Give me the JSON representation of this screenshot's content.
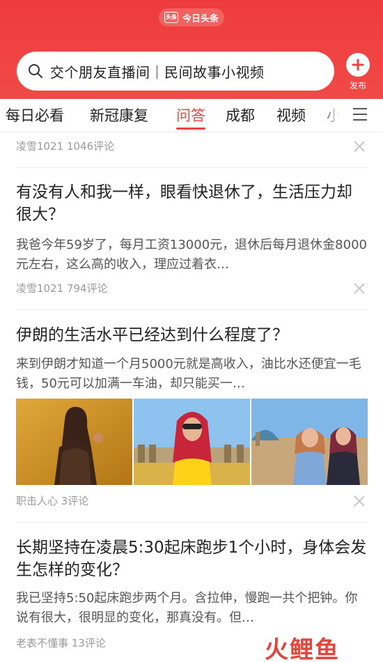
{
  "header": {
    "app_name": "今日头条",
    "badge_text": "头条",
    "search_placeholder": "交个朋友直播间｜民间故事小视频",
    "publish_label": "发布",
    "brand_color": "#f04142"
  },
  "tabs": [
    {
      "label": "每日必看",
      "active": false
    },
    {
      "label": "新冠康复",
      "active": false
    },
    {
      "label": "问答",
      "active": true
    },
    {
      "label": "成都",
      "active": false
    },
    {
      "label": "视频",
      "active": false
    },
    {
      "label": "小",
      "active": false
    }
  ],
  "feed": [
    {
      "author": "凌雪1021",
      "comments": "1046评论"
    },
    {
      "title": "有没有人和我一样，眼看快退休了，生活压力却很大？",
      "snippet": "我爸今年59岁了，每月工资13000元，退休后每月退休金8000元左右，这么高的收入，理应过着衣…",
      "author": "凌雪1021",
      "comments": "794评论"
    },
    {
      "title": "伊朗的生活水平已经达到什么程度了？",
      "snippet": "来到伊朗才知道一个月5000元就是高收入，油比水还便宜一毛钱，50元可以加满一车油，却只能买一…",
      "author": "职击人心",
      "comments": "3评论"
    },
    {
      "title": "长期坚持在凌晨5:30起床跑步1个小时，身体会发生怎样的变化？",
      "snippet": "我已坚持5:50起床跑步两个月。含拉伸，慢跑一共个把钟。你说有很大，很明显的变化，那真没有。但…",
      "author": "老表不懂事",
      "comments": "13评论"
    }
  ],
  "watermark": "火鲤鱼"
}
